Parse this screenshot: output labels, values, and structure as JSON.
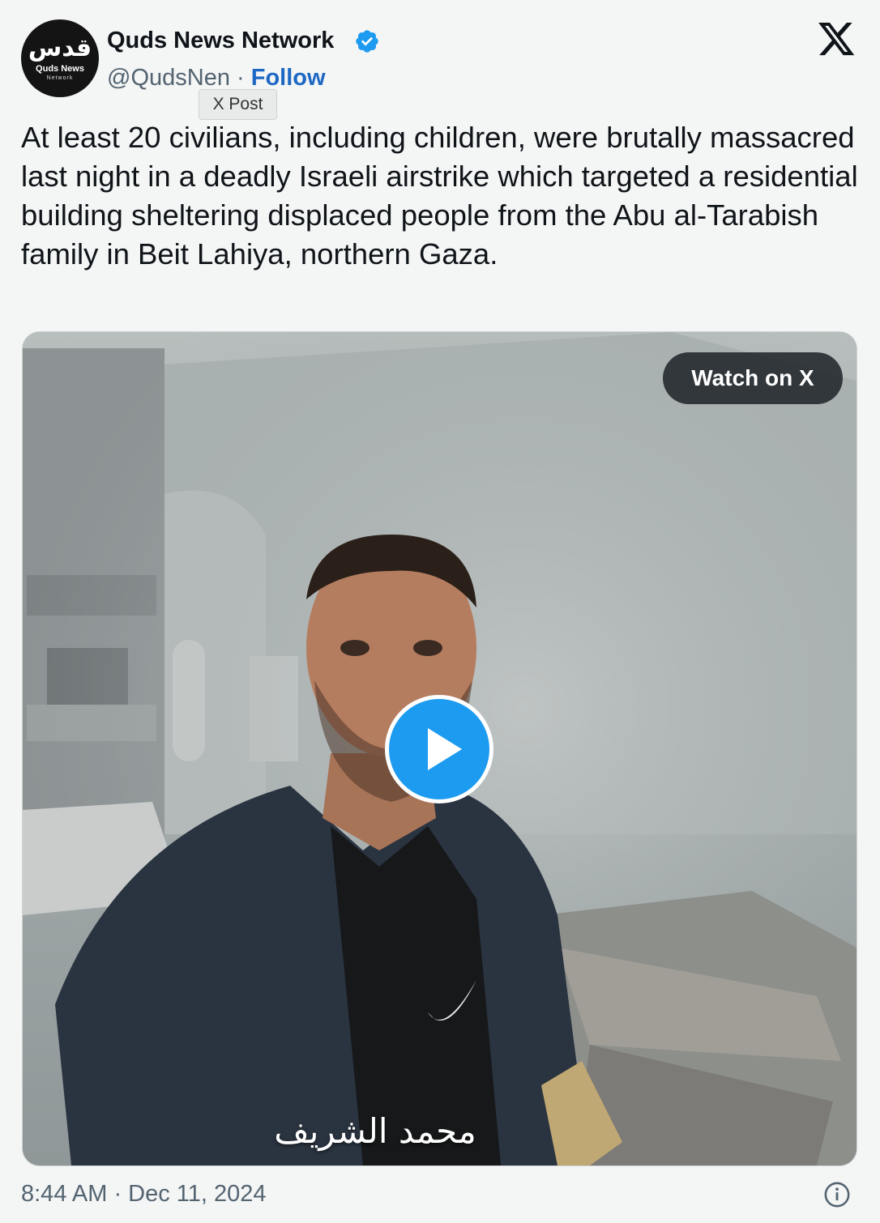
{
  "account": {
    "avatar_arabic": "قدس",
    "avatar_line1": "Quds News",
    "avatar_line2": "Network",
    "display_name": "Quds News Network",
    "handle": "@QudsNen",
    "separator": " · ",
    "follow_label": "Follow",
    "verified_icon": "verified-badge-icon"
  },
  "tooltip": "X Post",
  "tweet": {
    "text": "At least 20 civilians, including children, were brutally massacred last night in a deadly Israeli airstrike which targeted a residential building sheltering displaced people from the Abu al-Tarabish family in Beit Lahiya, northern Gaza."
  },
  "media": {
    "watch_label": "Watch on X",
    "caption": "محمد الشريف",
    "play_icon": "play-icon"
  },
  "footer": {
    "timestamp": "8:44 AM · Dec 11, 2024",
    "info_icon": "info-icon"
  },
  "colors": {
    "accent": "#1d9bf0",
    "follow": "#1d68c4",
    "muted": "#536471"
  }
}
